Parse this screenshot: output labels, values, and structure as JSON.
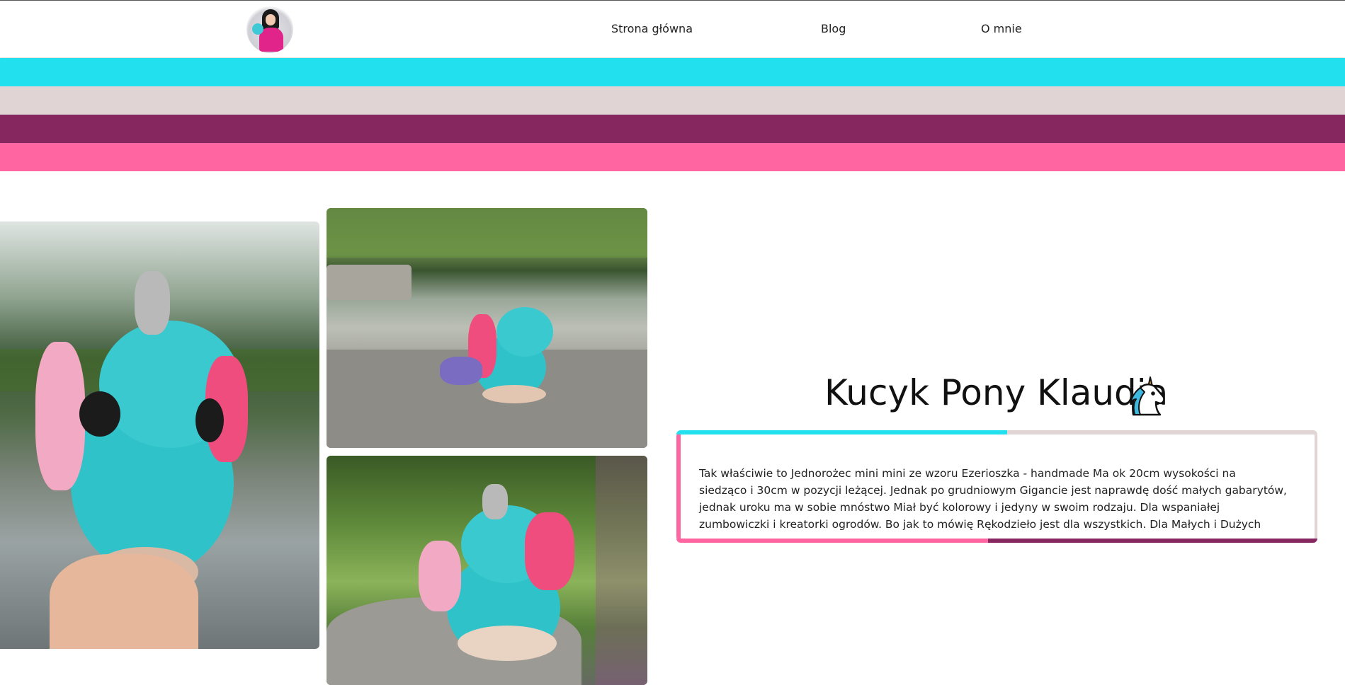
{
  "header": {
    "logo_alt": "avatar",
    "nav": [
      {
        "label": "Strona główna"
      },
      {
        "label": "Blog"
      },
      {
        "label": "O mnie"
      }
    ]
  },
  "stripes": [
    "#22e0ee",
    "#e0d4d4",
    "#87275f",
    "#ff66a1"
  ],
  "gallery": {
    "photos": [
      {
        "subject": "hand-holding-pony"
      },
      {
        "subject": "pony-on-rock-by-pond"
      },
      {
        "subject": "pony-on-rock-in-grass"
      }
    ]
  },
  "product": {
    "title": "Kucyk Pony Klaudia",
    "title_icon": "unicorn-icon",
    "description": "Tak właściwie to Jednorożec mini mini ze wzoru Ezerioszka - handmade Ma ok 20cm wysokości na siedząco i 30cm w pozycji leżącej. Jednak po grudniowym Gigancie jest naprawdę dość małych gabarytów, jednak uroku ma w sobie mnóstwo Miał być kolorowy i jedyny w swoim rodzaju. Dla wspaniałej zumbowiczki i kreatorki ogrodów. Bo jak to mówię Rękodzieło jest dla wszystkich. Dla Małych i Dużych"
  }
}
